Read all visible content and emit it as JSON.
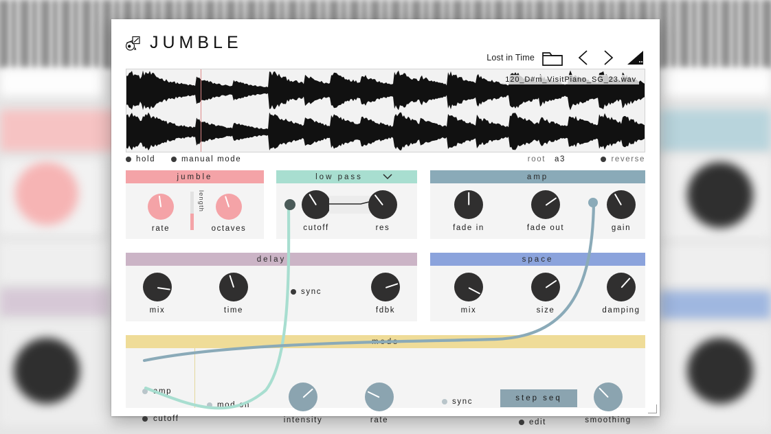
{
  "app": {
    "brand": "JUMBLE",
    "logo_icon": "jumble-logo-icon"
  },
  "header": {
    "preset_name": "Lost in Time",
    "folder_icon": "folder-icon",
    "prev_icon": "chevron-left-icon",
    "next_icon": "chevron-right-icon",
    "resize_icon": "resize-triangle-icon"
  },
  "waveform": {
    "file_name": "120_D#m_VisitPiano_SG_23.wav",
    "playhead_x_pct": 14.3,
    "channels": 2
  },
  "toolbar": {
    "hold": {
      "label": "hold",
      "on": true
    },
    "manual_mode": {
      "label": "manual mode",
      "on": true
    },
    "root_label": "root",
    "root_value": "a3",
    "reverse": {
      "label": "reverse",
      "on": true
    }
  },
  "panels": {
    "jumble": {
      "title": "jumble",
      "color": "#f4a3a7",
      "knobs": [
        {
          "label": "rate",
          "angle": -8
        },
        {
          "label": "octaves",
          "angle": -18
        }
      ],
      "slider": {
        "label": "length",
        "value_pct": 42
      }
    },
    "low_pass": {
      "title": "low pass",
      "color": "#a8ded0",
      "chevron_icon": "chevron-down-icon",
      "knobs": [
        {
          "label": "cutoff",
          "angle": -32
        },
        {
          "label": "res",
          "angle": -38
        }
      ],
      "mod_node": {
        "name": "cutoff-mod-node"
      }
    },
    "amp": {
      "title": "amp",
      "color": "#8aaab8",
      "knobs": [
        {
          "label": "fade in",
          "angle": 0
        },
        {
          "label": "fade out",
          "angle": 55
        },
        {
          "label": "gain",
          "angle": -30
        }
      ],
      "mod_node": {
        "name": "gain-mod-node"
      }
    },
    "delay": {
      "title": "delay",
      "color": "#cbb4c6",
      "knobs": [
        {
          "label": "mix",
          "angle": 98
        },
        {
          "label": "time",
          "angle": -18
        },
        {
          "label": "fdbk",
          "angle": 72
        }
      ],
      "sync": {
        "label": "sync",
        "on": true
      }
    },
    "space": {
      "title": "space",
      "color": "#8ba3dc",
      "knobs": [
        {
          "label": "mix",
          "angle": 118
        },
        {
          "label": "size",
          "angle": 56
        },
        {
          "label": "damping",
          "angle": 42
        }
      ]
    },
    "mods": {
      "title": "mods",
      "color": "#efdc98",
      "sources": [
        {
          "label": "amp",
          "on": false,
          "node": "amp-mod-source-node"
        },
        {
          "label": "cutoff",
          "on": true,
          "node": "cutoff-mod-source-node"
        }
      ],
      "mod_on": {
        "label": "mod on",
        "on": false
      },
      "knobs": [
        {
          "label": "intensity",
          "angle": 48
        },
        {
          "label": "rate",
          "angle": -64
        },
        {
          "label": "smoothing",
          "angle": -44
        }
      ],
      "sync": {
        "label": "sync",
        "on": false
      },
      "step_seq": {
        "label": "step seq"
      },
      "edit": {
        "label": "edit",
        "on": true
      }
    }
  },
  "cables": [
    {
      "name": "cutoff-cable",
      "color": "#a8ded0"
    },
    {
      "name": "amp-cable",
      "color": "#8aaab8"
    }
  ]
}
